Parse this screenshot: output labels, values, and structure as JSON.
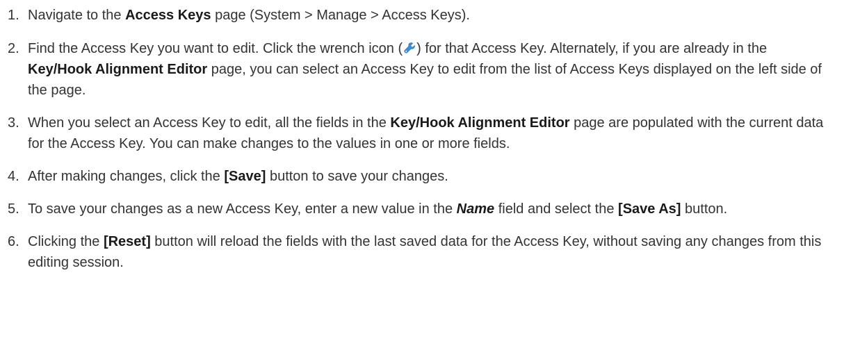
{
  "steps": [
    {
      "number": "1.",
      "segments": {
        "a": "Navigate to the ",
        "b": "Access Keys",
        "c": " page (System > Manage > Access Keys)."
      }
    },
    {
      "number": "2.",
      "segments": {
        "a": "Find the Access Key you want to edit. Click the wrench icon (",
        "icon": "wrench-icon",
        "b": ") for that Access Key. Alternately, if you are already in the ",
        "c": "Key/Hook Alignment Editor",
        "d": " page, you can select an Access Key to edit from the list of Access Keys displayed on the left side of the page."
      }
    },
    {
      "number": "3.",
      "segments": {
        "a": "When you select an Access Key to edit, all the fields in the ",
        "b": "Key/Hook Alignment Editor",
        "c": " page are populated with the current data for the Access Key. You can make changes to the values in one or more fields."
      }
    },
    {
      "number": "4.",
      "segments": {
        "a": "After making changes, click the ",
        "b": "[Save]",
        "c": " button to save your changes."
      }
    },
    {
      "number": "5.",
      "segments": {
        "a": "To save your changes as a new Access Key, enter a new value in the ",
        "b": "Name",
        "c": " field and select the ",
        "d": "[Save As]",
        "e": " button."
      }
    },
    {
      "number": "6.",
      "segments": {
        "a": "Clicking the ",
        "b": "[Reset]",
        "c": " button will reload the fields with the last saved data for the Access Key, without saving any changes from this editing session."
      }
    }
  ],
  "colors": {
    "text": "#333333",
    "wrench_icon": "#3d8fd8"
  }
}
